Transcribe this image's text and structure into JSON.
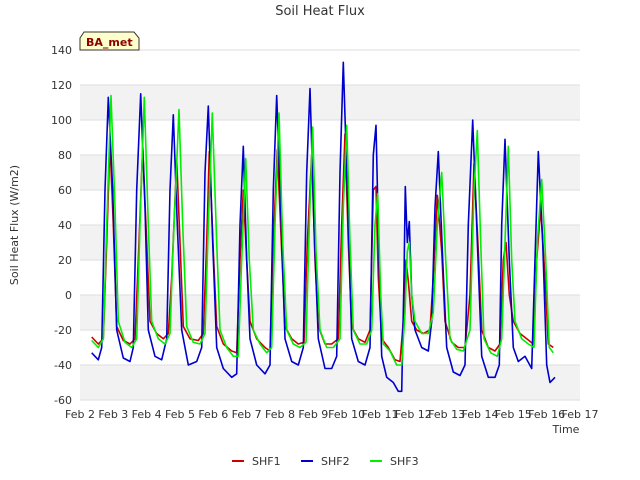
{
  "chart_data": {
    "type": "line",
    "title": "Soil Heat Flux",
    "xlabel": "Time",
    "ylabel": "Soil Heat Flux (W/m2)",
    "badge": "BA_met",
    "xlim": [
      2,
      17
    ],
    "ylim": [
      -60,
      140
    ],
    "yticks": [
      -60,
      -40,
      -20,
      0,
      20,
      40,
      60,
      80,
      100,
      120,
      140
    ],
    "xticks": [
      {
        "value": 2,
        "label": "Feb 2"
      },
      {
        "value": 3,
        "label": "Feb 3"
      },
      {
        "value": 4,
        "label": "Feb 4"
      },
      {
        "value": 5,
        "label": "Feb 5"
      },
      {
        "value": 6,
        "label": "Feb 6"
      },
      {
        "value": 7,
        "label": "Feb 7"
      },
      {
        "value": 8,
        "label": "Feb 8"
      },
      {
        "value": 9,
        "label": "Feb 9"
      },
      {
        "value": 10,
        "label": "Feb 10"
      },
      {
        "value": 11,
        "label": "Feb 11"
      },
      {
        "value": 12,
        "label": "Feb 12"
      },
      {
        "value": 13,
        "label": "Feb 13"
      },
      {
        "value": 14,
        "label": "Feb 14"
      },
      {
        "value": 15,
        "label": "Feb 15"
      },
      {
        "value": 16,
        "label": "Feb 16"
      },
      {
        "value": 17,
        "label": "Feb 17"
      }
    ],
    "grid": true,
    "legend_position": "bottom",
    "series": [
      {
        "name": "SHF1",
        "color": "#cc0000",
        "points": [
          [
            2.35,
            -24
          ],
          [
            2.55,
            -28
          ],
          [
            2.7,
            -25
          ],
          [
            2.8,
            30
          ],
          [
            2.9,
            87
          ],
          [
            3.0,
            40
          ],
          [
            3.1,
            -18
          ],
          [
            3.3,
            -26
          ],
          [
            3.5,
            -28
          ],
          [
            3.65,
            -25
          ],
          [
            3.75,
            20
          ],
          [
            3.88,
            85
          ],
          [
            4.0,
            30
          ],
          [
            4.1,
            -15
          ],
          [
            4.3,
            -22
          ],
          [
            4.5,
            -25
          ],
          [
            4.65,
            -22
          ],
          [
            4.75,
            10
          ],
          [
            4.9,
            77
          ],
          [
            5.0,
            30
          ],
          [
            5.1,
            -18
          ],
          [
            5.3,
            -25
          ],
          [
            5.55,
            -26
          ],
          [
            5.7,
            -22
          ],
          [
            5.8,
            30
          ],
          [
            5.88,
            82
          ],
          [
            6.0,
            25
          ],
          [
            6.1,
            -18
          ],
          [
            6.3,
            -28
          ],
          [
            6.55,
            -32
          ],
          [
            6.7,
            -33
          ],
          [
            6.8,
            20
          ],
          [
            6.9,
            60
          ],
          [
            7.0,
            20
          ],
          [
            7.1,
            -15
          ],
          [
            7.3,
            -25
          ],
          [
            7.55,
            -30
          ],
          [
            7.7,
            -32
          ],
          [
            7.8,
            30
          ],
          [
            7.92,
            83
          ],
          [
            8.05,
            25
          ],
          [
            8.15,
            -18
          ],
          [
            8.35,
            -25
          ],
          [
            8.55,
            -28
          ],
          [
            8.72,
            -27
          ],
          [
            8.82,
            30
          ],
          [
            8.95,
            80
          ],
          [
            9.05,
            20
          ],
          [
            9.15,
            -18
          ],
          [
            9.35,
            -28
          ],
          [
            9.55,
            -28
          ],
          [
            9.75,
            -25
          ],
          [
            9.85,
            40
          ],
          [
            9.95,
            92
          ],
          [
            10.05,
            30
          ],
          [
            10.15,
            -18
          ],
          [
            10.35,
            -25
          ],
          [
            10.55,
            -27
          ],
          [
            10.7,
            -20
          ],
          [
            10.8,
            60
          ],
          [
            10.88,
            62
          ],
          [
            10.95,
            10
          ],
          [
            11.05,
            -25
          ],
          [
            11.25,
            -30
          ],
          [
            11.45,
            -37
          ],
          [
            11.6,
            -38
          ],
          [
            11.7,
            -15
          ],
          [
            11.78,
            20
          ],
          [
            11.85,
            8
          ],
          [
            11.95,
            -15
          ],
          [
            12.1,
            -20
          ],
          [
            12.3,
            -22
          ],
          [
            12.5,
            -20
          ],
          [
            12.6,
            10
          ],
          [
            12.72,
            57
          ],
          [
            12.85,
            25
          ],
          [
            12.95,
            -15
          ],
          [
            13.15,
            -27
          ],
          [
            13.35,
            -30
          ],
          [
            13.55,
            -30
          ],
          [
            13.7,
            0
          ],
          [
            13.82,
            75
          ],
          [
            13.95,
            25
          ],
          [
            14.05,
            -20
          ],
          [
            14.25,
            -30
          ],
          [
            14.45,
            -32
          ],
          [
            14.6,
            -28
          ],
          [
            14.7,
            20
          ],
          [
            14.78,
            30
          ],
          [
            14.88,
            0
          ],
          [
            15.0,
            -15
          ],
          [
            15.2,
            -22
          ],
          [
            15.4,
            -25
          ],
          [
            15.6,
            -28
          ],
          [
            15.7,
            20
          ],
          [
            15.82,
            50
          ],
          [
            15.95,
            10
          ],
          [
            16.05,
            -28
          ],
          [
            16.2,
            -30
          ]
        ]
      },
      {
        "name": "SHF2",
        "color": "#0000cc",
        "points": [
          [
            2.35,
            -33
          ],
          [
            2.55,
            -37
          ],
          [
            2.65,
            -30
          ],
          [
            2.75,
            60
          ],
          [
            2.85,
            113
          ],
          [
            2.98,
            60
          ],
          [
            3.1,
            -20
          ],
          [
            3.3,
            -36
          ],
          [
            3.5,
            -38
          ],
          [
            3.6,
            -30
          ],
          [
            3.7,
            60
          ],
          [
            3.82,
            115
          ],
          [
            3.95,
            50
          ],
          [
            4.05,
            -20
          ],
          [
            4.25,
            -35
          ],
          [
            4.45,
            -37
          ],
          [
            4.6,
            -25
          ],
          [
            4.7,
            60
          ],
          [
            4.8,
            103
          ],
          [
            4.92,
            40
          ],
          [
            5.05,
            -20
          ],
          [
            5.25,
            -40
          ],
          [
            5.5,
            -38
          ],
          [
            5.65,
            -30
          ],
          [
            5.75,
            70
          ],
          [
            5.85,
            108
          ],
          [
            5.98,
            30
          ],
          [
            6.1,
            -30
          ],
          [
            6.3,
            -42
          ],
          [
            6.55,
            -47
          ],
          [
            6.7,
            -45
          ],
          [
            6.8,
            40
          ],
          [
            6.9,
            85
          ],
          [
            7.0,
            20
          ],
          [
            7.1,
            -25
          ],
          [
            7.3,
            -40
          ],
          [
            7.55,
            -45
          ],
          [
            7.7,
            -40
          ],
          [
            7.8,
            60
          ],
          [
            7.9,
            114
          ],
          [
            8.02,
            50
          ],
          [
            8.15,
            -25
          ],
          [
            8.35,
            -38
          ],
          [
            8.55,
            -40
          ],
          [
            8.7,
            -30
          ],
          [
            8.8,
            70
          ],
          [
            8.9,
            118
          ],
          [
            9.02,
            40
          ],
          [
            9.15,
            -25
          ],
          [
            9.35,
            -42
          ],
          [
            9.55,
            -42
          ],
          [
            9.7,
            -35
          ],
          [
            9.8,
            70
          ],
          [
            9.9,
            133
          ],
          [
            10.02,
            60
          ],
          [
            10.15,
            -25
          ],
          [
            10.35,
            -38
          ],
          [
            10.55,
            -40
          ],
          [
            10.7,
            -30
          ],
          [
            10.8,
            80
          ],
          [
            10.88,
            97
          ],
          [
            10.97,
            20
          ],
          [
            11.05,
            -35
          ],
          [
            11.2,
            -47
          ],
          [
            11.4,
            -50
          ],
          [
            11.55,
            -55
          ],
          [
            11.65,
            -55
          ],
          [
            11.72,
            10
          ],
          [
            11.76,
            62
          ],
          [
            11.82,
            30
          ],
          [
            11.88,
            42
          ],
          [
            11.95,
            0
          ],
          [
            12.05,
            -20
          ],
          [
            12.25,
            -30
          ],
          [
            12.45,
            -32
          ],
          [
            12.55,
            -15
          ],
          [
            12.65,
            50
          ],
          [
            12.75,
            82
          ],
          [
            12.88,
            20
          ],
          [
            13.0,
            -30
          ],
          [
            13.2,
            -44
          ],
          [
            13.4,
            -46
          ],
          [
            13.55,
            -40
          ],
          [
            13.65,
            40
          ],
          [
            13.78,
            100
          ],
          [
            13.9,
            40
          ],
          [
            14.05,
            -35
          ],
          [
            14.25,
            -47
          ],
          [
            14.45,
            -47
          ],
          [
            14.58,
            -40
          ],
          [
            14.65,
            40
          ],
          [
            14.75,
            89
          ],
          [
            14.88,
            20
          ],
          [
            15.0,
            -30
          ],
          [
            15.15,
            -38
          ],
          [
            15.35,
            -35
          ],
          [
            15.55,
            -42
          ],
          [
            15.65,
            20
          ],
          [
            15.75,
            82
          ],
          [
            15.88,
            30
          ],
          [
            16.0,
            -40
          ],
          [
            16.1,
            -50
          ],
          [
            16.25,
            -47
          ]
        ]
      },
      {
        "name": "SHF3",
        "color": "#00ee00",
        "points": [
          [
            2.35,
            -26
          ],
          [
            2.55,
            -30
          ],
          [
            2.7,
            -25
          ],
          [
            2.8,
            40
          ],
          [
            2.93,
            114
          ],
          [
            3.05,
            50
          ],
          [
            3.15,
            -15
          ],
          [
            3.35,
            -27
          ],
          [
            3.55,
            -30
          ],
          [
            3.7,
            -25
          ],
          [
            3.8,
            40
          ],
          [
            3.93,
            113
          ],
          [
            4.05,
            40
          ],
          [
            4.15,
            -15
          ],
          [
            4.35,
            -25
          ],
          [
            4.55,
            -28
          ],
          [
            4.7,
            -22
          ],
          [
            4.8,
            30
          ],
          [
            4.97,
            106
          ],
          [
            5.08,
            40
          ],
          [
            5.2,
            -18
          ],
          [
            5.4,
            -27
          ],
          [
            5.6,
            -28
          ],
          [
            5.75,
            -22
          ],
          [
            5.85,
            40
          ],
          [
            5.97,
            104
          ],
          [
            6.1,
            30
          ],
          [
            6.2,
            -20
          ],
          [
            6.4,
            -30
          ],
          [
            6.6,
            -35
          ],
          [
            6.75,
            -35
          ],
          [
            6.85,
            20
          ],
          [
            6.97,
            78
          ],
          [
            7.08,
            20
          ],
          [
            7.2,
            -20
          ],
          [
            7.4,
            -28
          ],
          [
            7.6,
            -33
          ],
          [
            7.75,
            -30
          ],
          [
            7.85,
            40
          ],
          [
            7.97,
            104
          ],
          [
            8.08,
            30
          ],
          [
            8.2,
            -20
          ],
          [
            8.4,
            -28
          ],
          [
            8.6,
            -30
          ],
          [
            8.78,
            -27
          ],
          [
            8.88,
            40
          ],
          [
            8.98,
            96
          ],
          [
            9.08,
            25
          ],
          [
            9.2,
            -20
          ],
          [
            9.4,
            -30
          ],
          [
            9.6,
            -30
          ],
          [
            9.8,
            -25
          ],
          [
            9.9,
            50
          ],
          [
            10.0,
            97
          ],
          [
            10.1,
            30
          ],
          [
            10.2,
            -20
          ],
          [
            10.4,
            -28
          ],
          [
            10.6,
            -28
          ],
          [
            10.75,
            -20
          ],
          [
            10.85,
            40
          ],
          [
            10.93,
            58
          ],
          [
            11.02,
            0
          ],
          [
            11.1,
            -28
          ],
          [
            11.3,
            -32
          ],
          [
            11.5,
            -40
          ],
          [
            11.65,
            -40
          ],
          [
            11.75,
            -10
          ],
          [
            11.82,
            25
          ],
          [
            11.88,
            30
          ],
          [
            11.95,
            0
          ],
          [
            12.05,
            -15
          ],
          [
            12.25,
            -22
          ],
          [
            12.45,
            -22
          ],
          [
            12.6,
            -10
          ],
          [
            12.72,
            40
          ],
          [
            12.85,
            70
          ],
          [
            12.97,
            20
          ],
          [
            13.1,
            -25
          ],
          [
            13.3,
            -31
          ],
          [
            13.5,
            -32
          ],
          [
            13.7,
            -20
          ],
          [
            13.82,
            60
          ],
          [
            13.92,
            94
          ],
          [
            14.02,
            30
          ],
          [
            14.12,
            -25
          ],
          [
            14.32,
            -33
          ],
          [
            14.52,
            -35
          ],
          [
            14.65,
            -25
          ],
          [
            14.75,
            30
          ],
          [
            14.85,
            85
          ],
          [
            14.95,
            20
          ],
          [
            15.05,
            -15
          ],
          [
            15.25,
            -25
          ],
          [
            15.45,
            -28
          ],
          [
            15.62,
            -30
          ],
          [
            15.72,
            30
          ],
          [
            15.85,
            66
          ],
          [
            15.97,
            20
          ],
          [
            16.08,
            -30
          ],
          [
            16.2,
            -33
          ]
        ]
      }
    ]
  }
}
